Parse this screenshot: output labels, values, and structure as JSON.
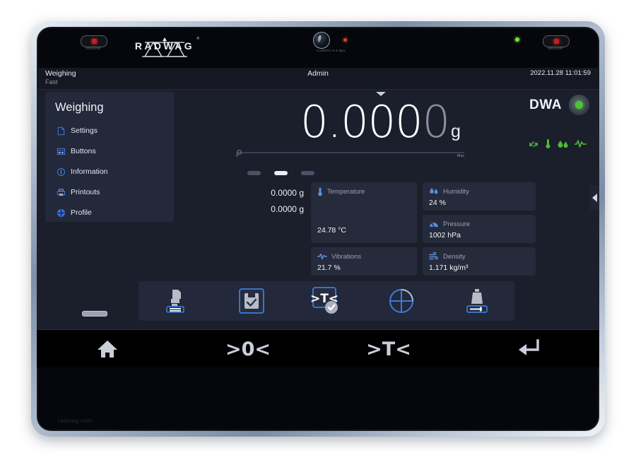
{
  "device": {
    "brand": "RADWAG",
    "brand_mark": "®",
    "sensor_left_caption": "SENSOR",
    "sensor_right_caption": "SENSOR",
    "camera_caption": "CAMERA 5.0 Mpx",
    "footer_url": "radwag.com"
  },
  "statusbar": {
    "mode": "Weighing",
    "submode": "Fast",
    "user": "Admin",
    "datetime": "2022.11.28 11:01:59"
  },
  "menu": {
    "title": "Weighing",
    "items": [
      {
        "label": "Settings",
        "icon": "document-icon"
      },
      {
        "label": "Buttons",
        "icon": "buttons-icon"
      },
      {
        "label": "Information",
        "icon": "info-icon"
      },
      {
        "label": "Printouts",
        "icon": "printer-icon"
      },
      {
        "label": "Profile",
        "icon": "profile-icon"
      }
    ]
  },
  "weight": {
    "value_stable": "0.000",
    "value_last_digit": "0",
    "unit": "g",
    "bargraph_min": "0",
    "bargraph_max": "Max",
    "bargraph_percent": 0
  },
  "dwa": {
    "label": "DWA",
    "led_color": "#4fc23a",
    "status_icons": [
      {
        "name": "airflow-icon",
        "color": "#4fbb34"
      },
      {
        "name": "thermometer-icon",
        "color": "#4fbb34"
      },
      {
        "name": "humidity-icon",
        "color": "#4fbb34"
      },
      {
        "name": "vibration-icon",
        "color": "#4fbb34"
      }
    ]
  },
  "readings": {
    "pages": [
      "page-1",
      "page-2",
      "page-3"
    ],
    "active_page": 1,
    "values": [
      "0.0000 g",
      "0.0000 g"
    ]
  },
  "sensors": [
    {
      "key": "temperature",
      "title": "Temperature",
      "value": "24.78 °C",
      "icon": "thermometer-icon"
    },
    {
      "key": "humidity",
      "title": "Humidity",
      "value": "24 %",
      "icon": "humidity-icon"
    },
    {
      "key": "pressure",
      "title": "Pressure",
      "value": "1002 hPa",
      "icon": "pressure-icon"
    },
    {
      "key": "vibrations",
      "title": "Vibrations",
      "value": "21.7 %",
      "icon": "vibration-icon"
    },
    {
      "key": "density",
      "title": "Density",
      "value": "1.171 kg/m³",
      "icon": "density-icon"
    }
  ],
  "toolbar": {
    "buttons": [
      {
        "name": "print-report-button",
        "icon": "printer-report-icon"
      },
      {
        "name": "save-button",
        "icon": "save-check-icon"
      },
      {
        "name": "tare-confirm-button",
        "icon": "tare-check-icon"
      },
      {
        "name": "pipette-button",
        "icon": "quadrant-circle-icon"
      },
      {
        "name": "adjustment-button",
        "icon": "weight-slider-icon"
      }
    ]
  },
  "navbar": {
    "buttons": [
      {
        "name": "home-button",
        "icon": "home-icon",
        "label": ""
      },
      {
        "name": "zero-button",
        "icon": "zero-icon",
        "label": ">0<"
      },
      {
        "name": "tare-button",
        "icon": "tare-icon",
        "label": ">T<"
      },
      {
        "name": "enter-button",
        "icon": "enter-icon",
        "label": "↵"
      }
    ]
  },
  "colors": {
    "screen_bg": "#1b1e2b",
    "panel_bg": "#23283a",
    "card_bg": "#262b3c",
    "accent_blue": "#3b7ddd",
    "status_green": "#4fbb34"
  }
}
